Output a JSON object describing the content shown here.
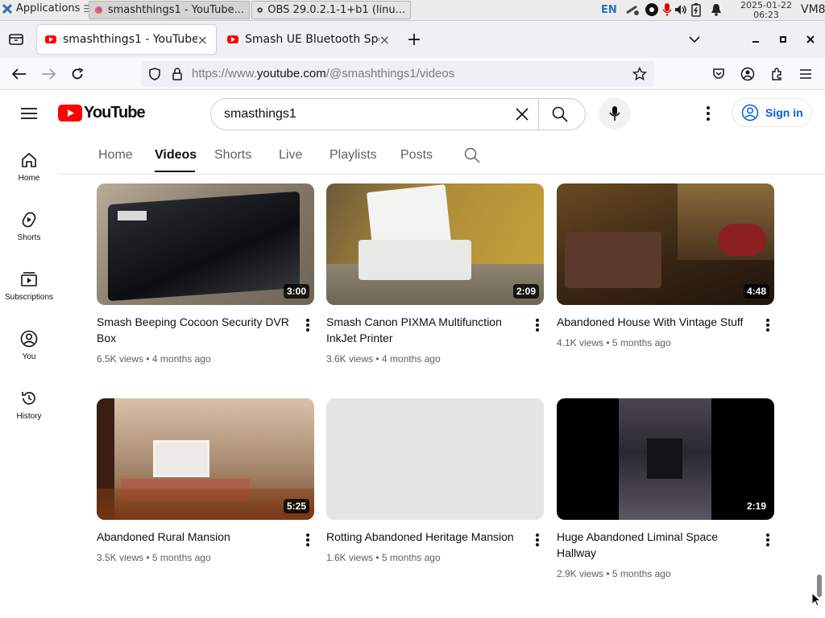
{
  "taskbar": {
    "apps_label": "Applications",
    "tasks": [
      {
        "title": "smashthings1 - YouTube..."
      },
      {
        "title": "OBS 29.0.2.1-1+b1 (linu..."
      }
    ],
    "lang": "EN",
    "date": "2025-01-22",
    "time": "06:23",
    "host": "VM8"
  },
  "browser": {
    "tabs": [
      {
        "title": "smashthings1 - YouTube",
        "active": true
      },
      {
        "title": "Smash UE Bluetooth Spe",
        "active": false
      }
    ],
    "url_prefix": "https://www.",
    "url_domain": "youtube.com",
    "url_path": "/@smashthings1/videos"
  },
  "youtube": {
    "logo_text": "YouTube",
    "search_value": "smasthings1",
    "sign_in_label": "Sign in",
    "sidebar": [
      {
        "label": "Home",
        "icon": "home-icon"
      },
      {
        "label": "Shorts",
        "icon": "shorts-icon"
      },
      {
        "label": "Subscriptions",
        "icon": "subscriptions-icon"
      },
      {
        "label": "You",
        "icon": "you-icon"
      },
      {
        "label": "History",
        "icon": "history-icon"
      }
    ],
    "channel_tabs": [
      "Home",
      "Videos",
      "Shorts",
      "Live",
      "Playlists",
      "Posts"
    ],
    "selected_tab": "Videos",
    "videos": [
      {
        "title": "Smash Beeping Cocoon Security DVR Box",
        "views": "6.5K views",
        "age": "4 months ago",
        "duration": "3:00"
      },
      {
        "title": "Smash Canon PIXMA Multifunction InkJet Printer",
        "views": "3.6K views",
        "age": "4 months ago",
        "duration": "2:09"
      },
      {
        "title": "Abandoned House With Vintage Stuff",
        "views": "4.1K views",
        "age": "5 months ago",
        "duration": "4:48"
      },
      {
        "title": "Abandoned Rural Mansion",
        "views": "3.5K views",
        "age": "5 months ago",
        "duration": "5:25"
      },
      {
        "title": "Rotting Abandoned Heritage Mansion",
        "views": "1.6K views",
        "age": "5 months ago",
        "duration": ""
      },
      {
        "title": "Huge Abandoned Liminal Space Hallway",
        "views": "2.9K views",
        "age": "5 months ago",
        "duration": "2:19"
      }
    ],
    "meta_separator": "•"
  },
  "colors": {
    "youtube_red": "#ff0000",
    "link_blue": "#065fd4",
    "meta_gray": "#606060"
  }
}
